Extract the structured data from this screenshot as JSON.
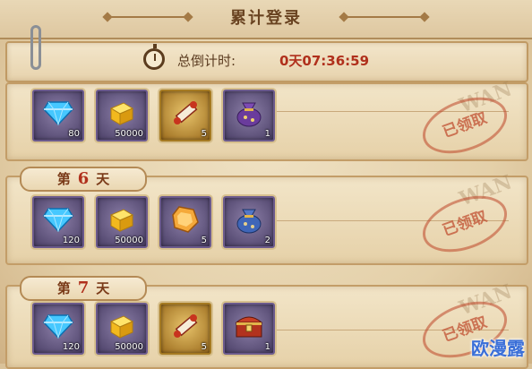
{
  "header": {
    "title": "累计登录"
  },
  "timer": {
    "label": "总倒计时:",
    "value": "0天07:36:59"
  },
  "rows": [
    {
      "day_prefix": "",
      "day_num": "",
      "day_suffix": "",
      "items": [
        {
          "icon": "diamond-icon",
          "count": "80"
        },
        {
          "icon": "gold-ingot-icon",
          "count": "50000"
        },
        {
          "icon": "scroll-icon",
          "count": "5"
        },
        {
          "icon": "pouch-icon",
          "count": "1"
        }
      ],
      "stamp": "已领取",
      "stamp_mark": "WAN"
    },
    {
      "day_prefix": "第",
      "day_num": "6",
      "day_suffix": "天",
      "items": [
        {
          "icon": "diamond-icon",
          "count": "120"
        },
        {
          "icon": "gold-ingot-icon",
          "count": "50000"
        },
        {
          "icon": "amber-gem-icon",
          "count": "5"
        },
        {
          "icon": "pouch-icon",
          "count": "2"
        }
      ],
      "stamp": "已领取",
      "stamp_mark": "WAN"
    },
    {
      "day_prefix": "第",
      "day_num": "7",
      "day_suffix": "天",
      "items": [
        {
          "icon": "diamond-icon",
          "count": "120"
        },
        {
          "icon": "gold-ingot-icon",
          "count": "50000"
        },
        {
          "icon": "scroll-icon",
          "count": "5"
        },
        {
          "icon": "treasure-chest-icon",
          "count": "1"
        }
      ],
      "stamp": "已领取",
      "stamp_mark": "WAN"
    }
  ],
  "watermark": "欧漫露",
  "colors": {
    "accent": "#b0301c",
    "parchment": "#efe1c3",
    "border": "#c39d68"
  }
}
